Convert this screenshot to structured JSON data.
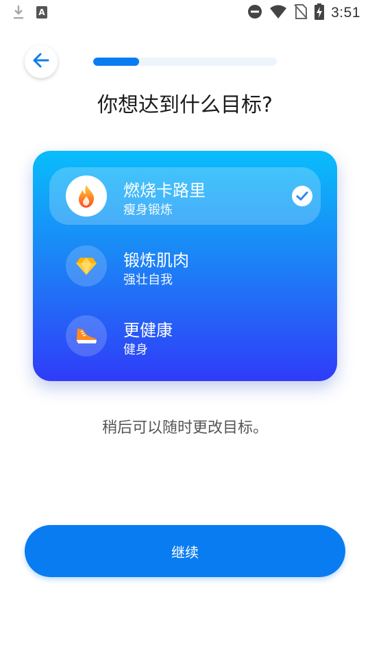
{
  "status_bar": {
    "time": "3:51",
    "icons": [
      "download-icon",
      "keyboard-icon",
      "do-not-disturb-icon",
      "wifi-icon",
      "no-sim-icon",
      "battery-charging-icon"
    ]
  },
  "header": {
    "back_icon": "arrow-left-icon",
    "progress": 0.25
  },
  "title": "你想达到什么目标?",
  "goals": [
    {
      "title": "燃烧卡路里",
      "subtitle": "瘦身锻炼",
      "icon": "flame-icon",
      "selected": true
    },
    {
      "title": "锻炼肌肉",
      "subtitle": "强壮自我",
      "icon": "diamond-icon",
      "selected": false
    },
    {
      "title": "更健康",
      "subtitle": "健身",
      "icon": "sneaker-icon",
      "selected": false
    }
  ],
  "hint": "稍后可以随时更改目标。",
  "continue_label": "继续",
  "colors": {
    "accent": "#0A7CF2",
    "card_top": "#09BDFB",
    "card_bottom": "#2F3CF8"
  }
}
